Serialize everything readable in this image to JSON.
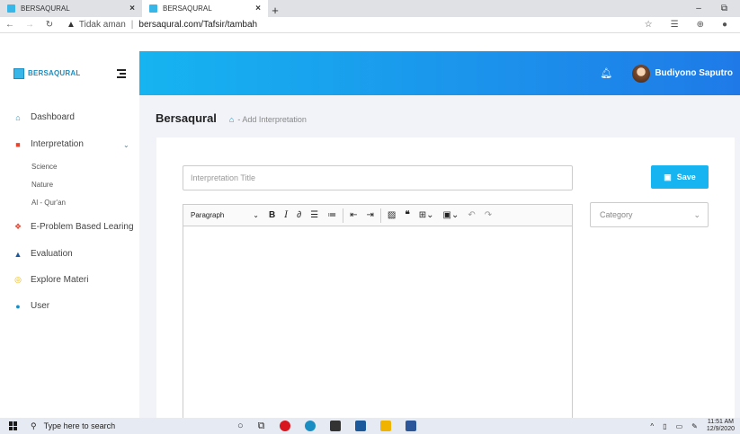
{
  "browser": {
    "tabs": [
      {
        "title": "BERSAQURAL",
        "active": false
      },
      {
        "title": "BERSAQURAL",
        "active": true
      }
    ],
    "new_tab": "+",
    "security_label": "Tidak aman",
    "separator": "|",
    "url": "bersaqural.com/Tafsir/tambah"
  },
  "header": {
    "brand": "BERSAQURAL",
    "user_name": "Budiyono Saputro",
    "gradient_start": "#16b4f0",
    "gradient_end": "#1f7ae8"
  },
  "sidebar": {
    "items": [
      {
        "label": "Dashboard",
        "icon": "home-icon"
      },
      {
        "label": "Interpretation",
        "icon": "book-icon"
      },
      {
        "label": "E-Problem Based Learing",
        "icon": "gift-icon"
      },
      {
        "label": "Evaluation",
        "icon": "graduation-cap-icon"
      },
      {
        "label": "Explore Materi",
        "icon": "compass-icon"
      },
      {
        "label": "User",
        "icon": "user-icon"
      }
    ],
    "sub_items": [
      "Science",
      "Nature",
      "Al - Qur'an"
    ]
  },
  "main": {
    "breadcrumb_title": "Bersaqural",
    "breadcrumb_sub": "- Add Interpretation",
    "title_placeholder": "Interpretation Title",
    "save_label": "Save",
    "category_placeholder": "Category",
    "toolbar_format": "Paragraph"
  },
  "taskbar": {
    "search_placeholder": "Type here to search",
    "time": "11:51 AM",
    "date": "12/9/2020"
  }
}
